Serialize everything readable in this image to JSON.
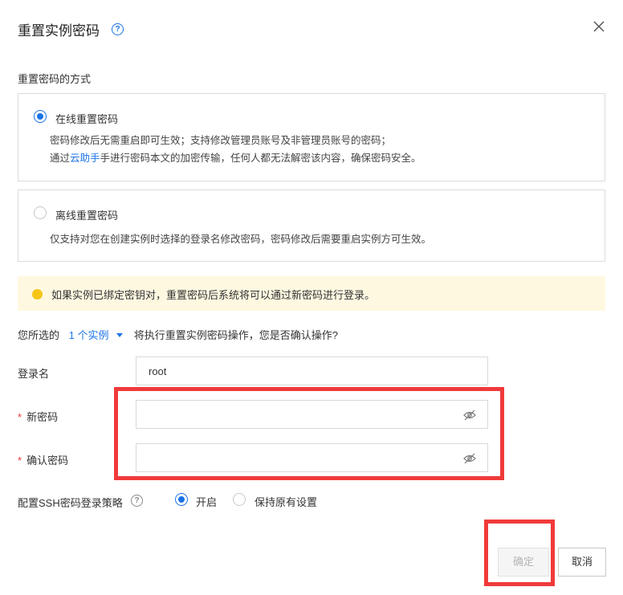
{
  "dialog": {
    "title": "重置实例密码",
    "help_icon": "question-circle-icon",
    "close_icon": "close-icon"
  },
  "method": {
    "section_label": "重置密码的方式",
    "options": [
      {
        "label": "在线重置密码",
        "selected": true,
        "desc_line1": "密码修改后无需重启即可生效；支持修改管理员账号及非管理员账号的密码；",
        "desc_line2_prefix": "通过",
        "desc_line2_link": "云助手",
        "desc_line2_suffix": "手进行密码本文的加密传输，任何人都无法解密该内容，确保密码安全。"
      },
      {
        "label": "离线重置密码",
        "selected": false,
        "desc_line1": "仅支持对您在创建实例时选择的登录名修改密码，密码修改后需要重启实例方可生效。"
      }
    ]
  },
  "notice": {
    "text": "如果实例已绑定密钥对，重置密码后系统将可以通过新密码进行登录。",
    "color": "#f5c518"
  },
  "selection": {
    "prefix": "您所选的",
    "link": "1 个实例",
    "suffix": "将执行重置实例密码操作，您是否确认操作?"
  },
  "form": {
    "login_label": "登录名",
    "login_value": "root",
    "new_password_label": "新密码",
    "confirm_password_label": "确认密码",
    "required_mark": "*",
    "ssh_label": "配置SSH密码登录策略",
    "ssh_options": [
      {
        "label": "开启",
        "selected": true
      },
      {
        "label": "保持原有设置",
        "selected": false
      }
    ]
  },
  "footer": {
    "ok_label": "确定",
    "cancel_label": "取消"
  },
  "colors": {
    "accent": "#1a73e8",
    "highlight": "#f03a3a",
    "notice_bg": "#fff8e1"
  }
}
